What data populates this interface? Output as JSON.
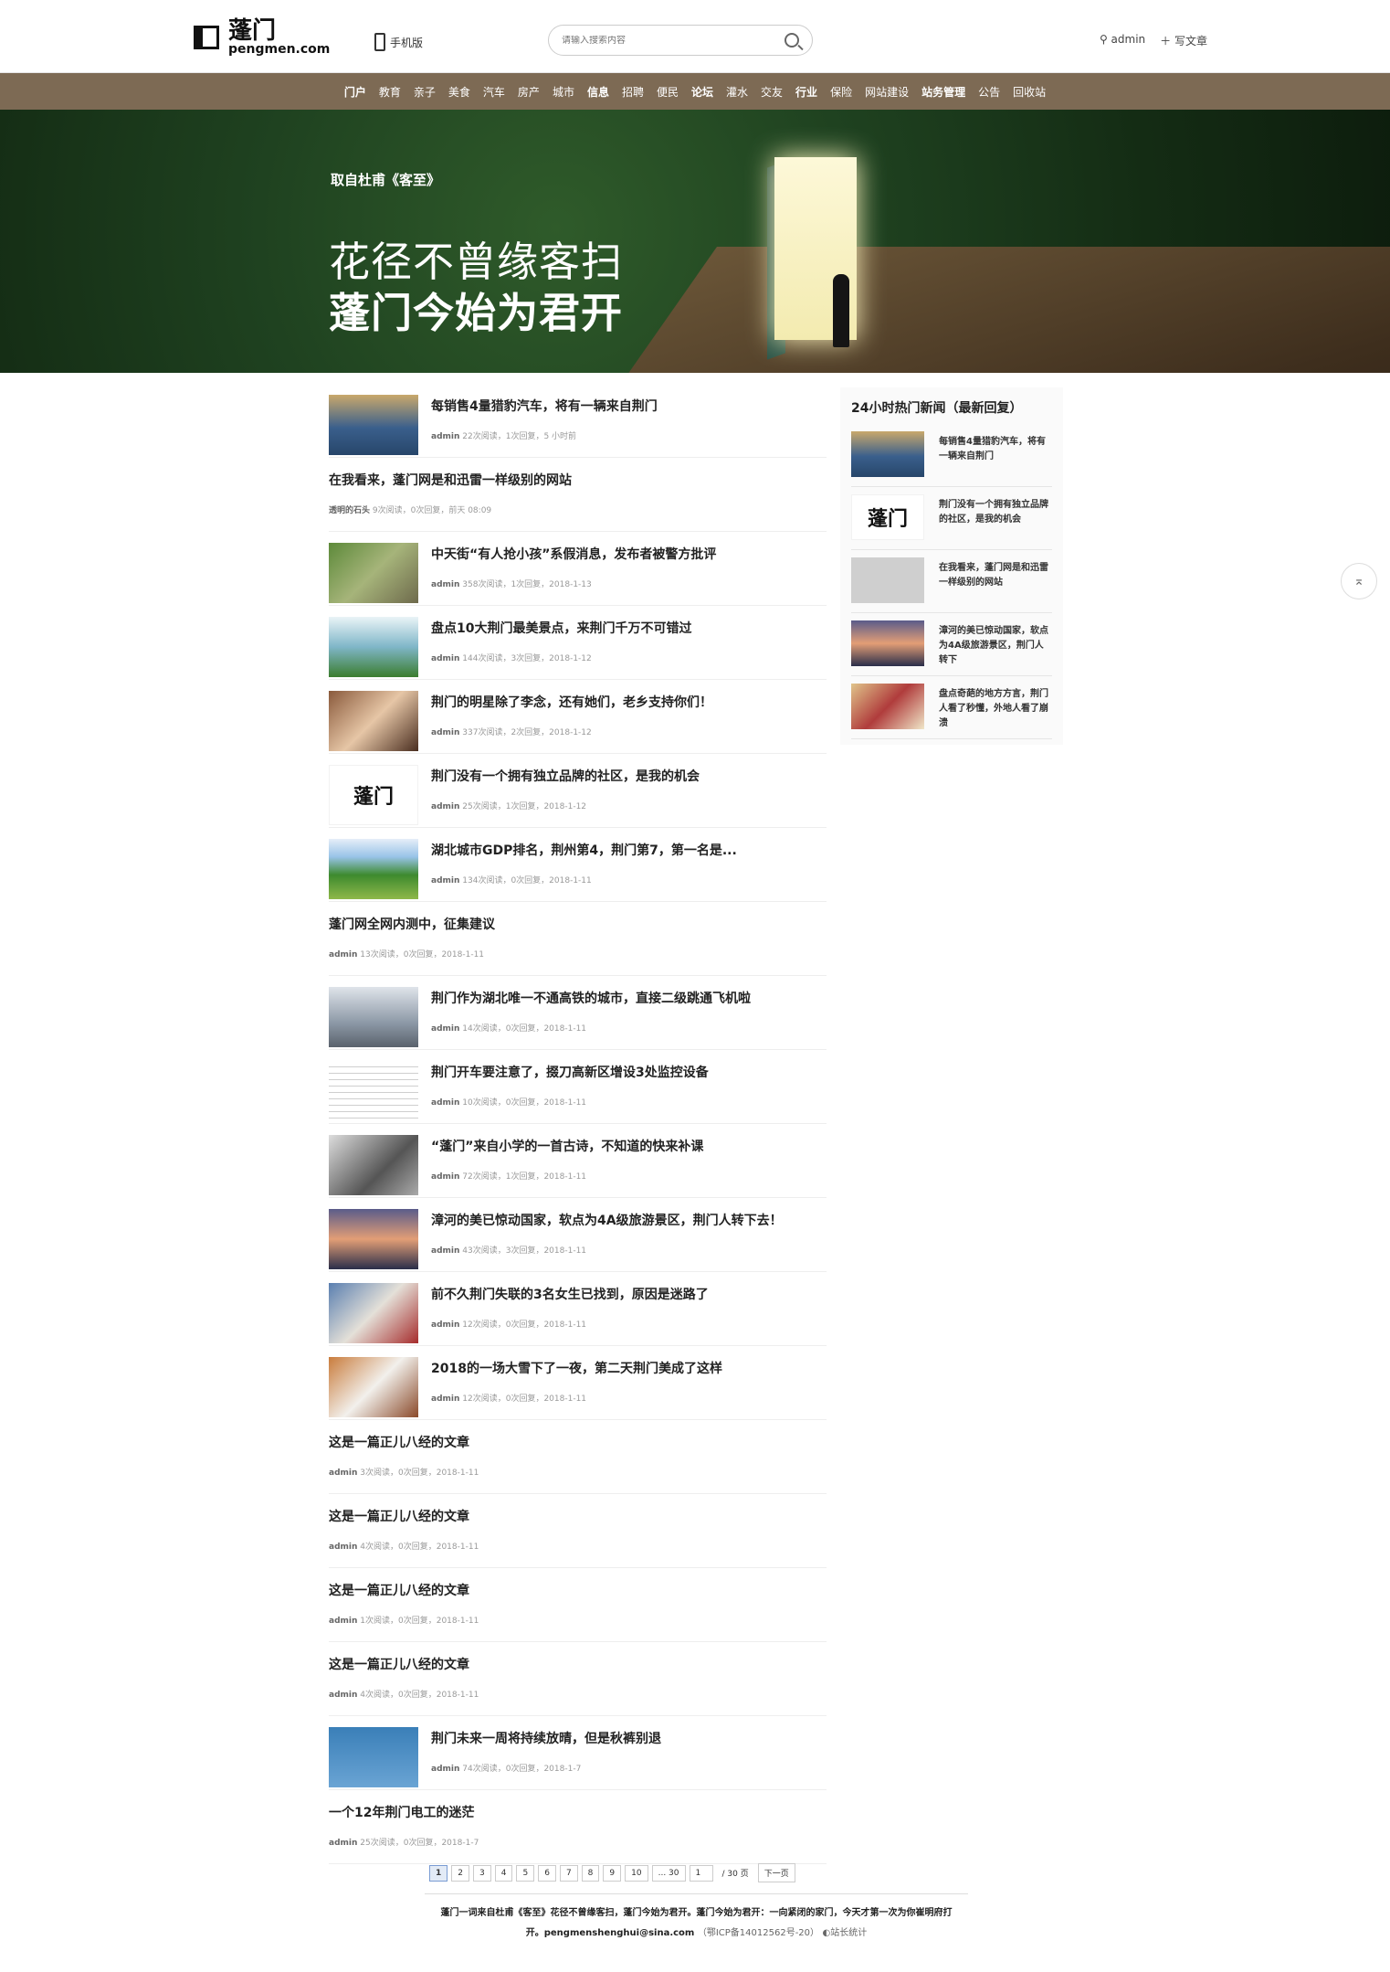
{
  "header": {
    "logo_cn": "蓬门",
    "logo_en": "pengmen.com",
    "mobile_label": "手机版",
    "search_placeholder": "请输入搜索内容",
    "user": "admin",
    "write": "写文章"
  },
  "nav": [
    {
      "label": "门户",
      "bold": true
    },
    {
      "label": "教育"
    },
    {
      "label": "亲子"
    },
    {
      "label": "美食"
    },
    {
      "label": "汽车"
    },
    {
      "label": "房产"
    },
    {
      "label": "城市"
    },
    {
      "label": "信息",
      "bold": true
    },
    {
      "label": "招聘"
    },
    {
      "label": "便民"
    },
    {
      "label": "论坛",
      "bold": true
    },
    {
      "label": "灌水"
    },
    {
      "label": "交友"
    },
    {
      "label": "行业",
      "bold": true
    },
    {
      "label": "保险"
    },
    {
      "label": "网站建设"
    },
    {
      "label": "站务管理",
      "bold": true
    },
    {
      "label": "公告"
    },
    {
      "label": "回收站"
    }
  ],
  "banner": {
    "sub": "取自杜甫《客至》",
    "line1": "花径不曾缘客扫",
    "line2": "蓬门今始为君开"
  },
  "articles": [
    {
      "title": "每销售4量猎豹汽车，将有一辆来自荆门",
      "author": "admin",
      "meta": "22次阅读，1次回复，5 小时前",
      "thumb": "gr1"
    },
    {
      "title": "在我看来，蓬门网是和迅雷一样级别的网站",
      "author": "透明的石头",
      "meta": "9次阅读，0次回复，前天 08:09",
      "thumb": ""
    },
    {
      "title": "中天街“有人抢小孩”系假消息，发布者被警方批评",
      "author": "admin",
      "meta": "358次阅读，1次回复，2018-1-13",
      "thumb": "gr2"
    },
    {
      "title": "盘点10大荆门最美景点，来荆门千万不可错过",
      "author": "admin",
      "meta": "144次阅读，3次回复，2018-1-12",
      "thumb": "gr3"
    },
    {
      "title": "荆门的明星除了李念，还有她们，老乡支持你们！",
      "author": "admin",
      "meta": "337次阅读，2次回复，2018-1-12",
      "thumb": "gr4"
    },
    {
      "title": "荆门没有一个拥有独立品牌的社区，是我的机会",
      "author": "admin",
      "meta": "25次阅读，1次回复，2018-1-12",
      "thumb": "logo"
    },
    {
      "title": "湖北城市GDP排名，荆州第4，荆门第7，第一名是...",
      "author": "admin",
      "meta": "134次阅读，0次回复，2018-1-11",
      "thumb": "gr5"
    },
    {
      "title": "蓬门网全网内测中，征集建议",
      "author": "admin",
      "meta": "13次阅读，0次回复，2018-1-11",
      "thumb": ""
    },
    {
      "title": "荆门作为湖北唯一不通高铁的城市，直接二级跳通飞机啦",
      "author": "admin",
      "meta": "14次阅读，0次回复，2018-1-11",
      "thumb": "gr6"
    },
    {
      "title": "荆门开车要注意了，掇刀高新区增设3处监控设备",
      "author": "admin",
      "meta": "10次阅读，0次回复，2018-1-11",
      "thumb": "gr7"
    },
    {
      "title": "“蓬门”来自小学的一首古诗，不知道的快来补课",
      "author": "admin",
      "meta": "72次阅读，1次回复，2018-1-11",
      "thumb": "gr8"
    },
    {
      "title": "漳河的美已惊动国家，软点为4A级旅游景区，荆门人转下去！",
      "author": "admin",
      "meta": "43次阅读，3次回复，2018-1-11",
      "thumb": "gr9"
    },
    {
      "title": "前不久荆门失联的3名女生已找到，原因是迷路了",
      "author": "admin",
      "meta": "12次阅读，0次回复，2018-1-11",
      "thumb": "gr10"
    },
    {
      "title": "2018的一场大雪下了一夜，第二天荆门美成了这样",
      "author": "admin",
      "meta": "12次阅读，0次回复，2018-1-11",
      "thumb": "gr11"
    },
    {
      "title": "这是一篇正儿八经的文章",
      "author": "admin",
      "meta": "3次阅读，0次回复，2018-1-11",
      "thumb": ""
    },
    {
      "title": "这是一篇正儿八经的文章",
      "author": "admin",
      "meta": "4次阅读，0次回复，2018-1-11",
      "thumb": ""
    },
    {
      "title": "这是一篇正儿八经的文章",
      "author": "admin",
      "meta": "1次阅读，0次回复，2018-1-11",
      "thumb": ""
    },
    {
      "title": "这是一篇正儿八经的文章",
      "author": "admin",
      "meta": "4次阅读，0次回复，2018-1-11",
      "thumb": ""
    },
    {
      "title": "荆门未来一周将持续放晴，但是秋裤别退",
      "author": "admin",
      "meta": "74次阅读，0次回复，2018-1-7",
      "thumb": "gr12"
    },
    {
      "title": "一个12年荆门电工的迷茫",
      "author": "admin",
      "meta": "25次阅读，0次回复，2018-1-7",
      "thumb": ""
    }
  ],
  "side": {
    "title": "24小时热门新闻（最新回复）",
    "items": [
      {
        "text": "每销售4量猎豹汽车，将有一辆来自荆门",
        "thumb": "gr1"
      },
      {
        "text": "荆门没有一个拥有独立品牌的社区，是我的机会",
        "thumb": "logo"
      },
      {
        "text": "在我看来，蓬门网是和迅雷一样级别的网站",
        "thumb": "gr13"
      },
      {
        "text": "漳河的美已惊动国家，软点为4A级旅游景区，荆门人转下",
        "thumb": "gr9"
      },
      {
        "text": "盘点奇葩的地方方言，荆门人看了秒懂，外地人看了崩溃",
        "thumb": "gr14"
      }
    ]
  },
  "pager": {
    "pages": [
      "1",
      "2",
      "3",
      "4",
      "5",
      "6",
      "7",
      "8",
      "9",
      "10",
      "... 30"
    ],
    "input": "1",
    "total": "/ 30 页",
    "next": "下一页"
  },
  "footer": {
    "line1": "蓬门一词来自杜甫《客至》花径不曾缘客扫，蓬门今始为君开。蓬门今始为君开：一向紧闭的家门，今天才第一次为你崔明府打",
    "line2a": "开。pengmenshenghui@sina.com",
    "icp": "（鄂ICP备14012562号-20）",
    "stat": "站长统计"
  }
}
